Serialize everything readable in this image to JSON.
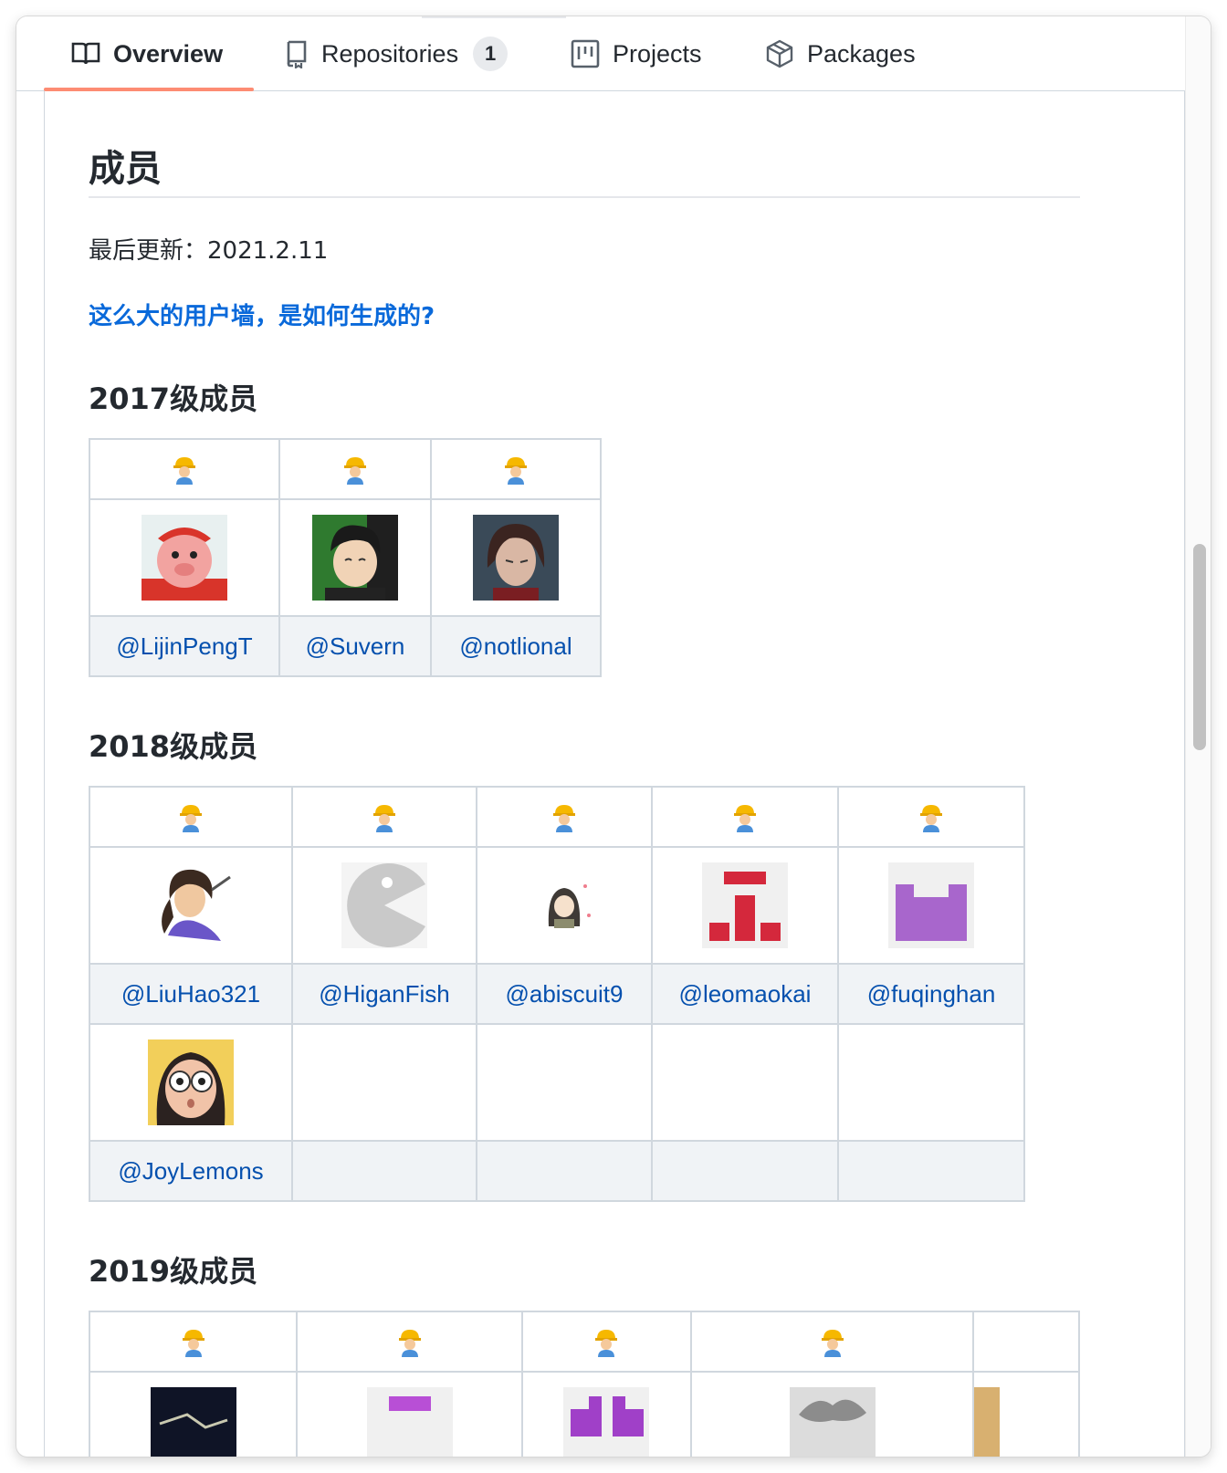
{
  "tabs": [
    {
      "label": "Overview",
      "icon": "book-icon",
      "selected": true
    },
    {
      "label": "Repositories",
      "icon": "repo-icon",
      "count": "1"
    },
    {
      "label": "Projects",
      "icon": "project-icon"
    },
    {
      "label": "Packages",
      "icon": "package-icon"
    }
  ],
  "readme": {
    "title": "成员",
    "updated": "最后更新：2021.2.11",
    "faq_link": "这么大的用户墙，是如何生成的?"
  },
  "sections": [
    {
      "heading": "2017级成员",
      "members": [
        "@LijinPengT",
        "@Suvern",
        "@notlional"
      ]
    },
    {
      "heading": "2018级成员",
      "members": [
        "@LiuHao321",
        "@HiganFish",
        "@abiscuit9",
        "@leomaokai",
        "@fuqinghan",
        "@JoyLemons"
      ]
    },
    {
      "heading": "2019级成员"
    }
  ],
  "colors": {
    "link": "#0969da",
    "selected_tab_underline": "#fd8c73",
    "name_cell_bg": "#f0f3f6"
  }
}
